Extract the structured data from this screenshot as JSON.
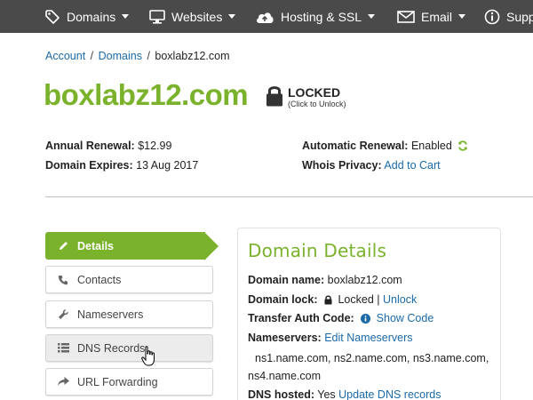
{
  "topnav": {
    "items": [
      {
        "label": "Domains",
        "icon": "tag-icon"
      },
      {
        "label": "Websites",
        "icon": "monitor-icon"
      },
      {
        "label": "Hosting & SSL",
        "icon": "cloud-upload-icon"
      },
      {
        "label": "Email",
        "icon": "envelope-icon"
      },
      {
        "label": "Supp",
        "icon": "info-icon"
      }
    ]
  },
  "breadcrumb": {
    "items": [
      "Account",
      "Domains"
    ],
    "current": "boxlabz12.com",
    "separator": "/"
  },
  "domain": {
    "title": "boxlabz12.com",
    "lock_label": "LOCKED",
    "lock_hint": "(Click to Unlock)"
  },
  "info": {
    "annual_renewal_label": "Annual Renewal:",
    "annual_renewal_value": "$12.99",
    "expires_label": "Domain Expires:",
    "expires_value": "13 Aug 2017",
    "auto_renewal_label": "Automatic Renewal:",
    "auto_renewal_value": "Enabled",
    "whois_label": "Whois Privacy:",
    "whois_link": "Add to Cart"
  },
  "sidenav": {
    "items": [
      {
        "label": "Details",
        "icon": "pencil-icon",
        "state": "active"
      },
      {
        "label": "Contacts",
        "icon": "phone-icon",
        "state": "default"
      },
      {
        "label": "Nameservers",
        "icon": "wrench-icon",
        "state": "default"
      },
      {
        "label": "DNS Records",
        "icon": "list-icon",
        "state": "hover"
      },
      {
        "label": "URL Forwarding",
        "icon": "share-arrow-icon",
        "state": "default"
      }
    ]
  },
  "details": {
    "title": "Domain Details",
    "name_label": "Domain name:",
    "name_value": "boxlabz12.com",
    "lock_label": "Domain lock:",
    "lock_value": "Locked",
    "lock_sep": "|",
    "unlock_link": "Unlock",
    "auth_label": "Transfer Auth Code:",
    "auth_link": "Show Code",
    "ns_label": "Nameservers:",
    "ns_link": "Edit Nameservers",
    "ns_list_line1": "ns1.name.com, ns2.name.com, ns3.name.com,",
    "ns_list_line2": "ns4.name.com",
    "dns_label": "DNS hosted:",
    "dns_value": "Yes",
    "dns_link": "Update DNS records"
  },
  "colors": {
    "brand_green": "#7ab22c",
    "link_blue": "#1a6aa8",
    "nav_bg": "#4a4a4a"
  }
}
